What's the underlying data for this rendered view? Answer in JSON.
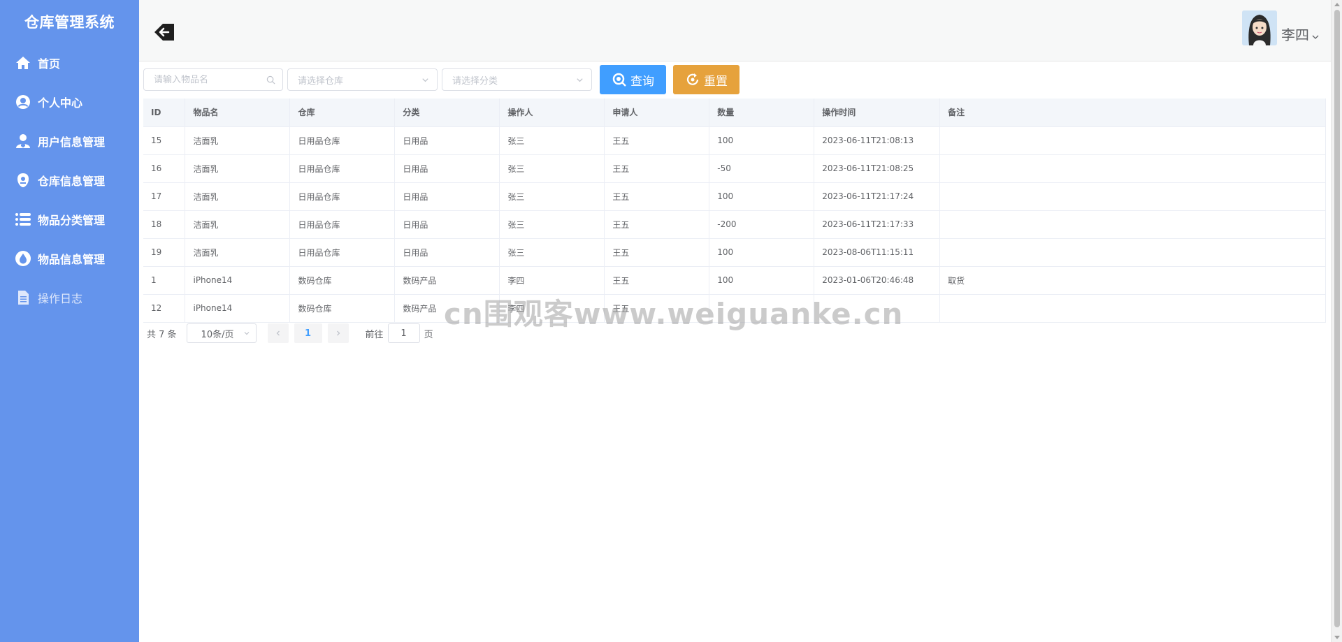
{
  "app": {
    "title": "仓库管理系统"
  },
  "sidebar": {
    "items": [
      {
        "label": "首页",
        "icon": "home-icon"
      },
      {
        "label": "个人中心",
        "icon": "user-center-icon"
      },
      {
        "label": "用户信息管理",
        "icon": "user-manage-icon"
      },
      {
        "label": "仓库信息管理",
        "icon": "warehouse-icon"
      },
      {
        "label": "物品分类管理",
        "icon": "list-icon"
      },
      {
        "label": "物品信息管理",
        "icon": "drop-icon"
      },
      {
        "label": "操作日志",
        "icon": "document-icon",
        "active": true
      }
    ]
  },
  "header": {
    "username": "李四"
  },
  "filters": {
    "name_placeholder": "请输入物品名",
    "warehouse_placeholder": "请选择仓库",
    "category_placeholder": "请选择分类",
    "search_label": "查询",
    "reset_label": "重置"
  },
  "table": {
    "columns": [
      "ID",
      "物品名",
      "仓库",
      "分类",
      "操作人",
      "申请人",
      "数量",
      "操作时间",
      "备注"
    ],
    "rows": [
      [
        "15",
        "洁面乳",
        "日用品仓库",
        "日用品",
        "张三",
        "王五",
        "100",
        "2023-06-11T21:08:13",
        ""
      ],
      [
        "16",
        "洁面乳",
        "日用品仓库",
        "日用品",
        "张三",
        "王五",
        "-50",
        "2023-06-11T21:08:25",
        ""
      ],
      [
        "17",
        "洁面乳",
        "日用品仓库",
        "日用品",
        "张三",
        "王五",
        "100",
        "2023-06-11T21:17:24",
        ""
      ],
      [
        "18",
        "洁面乳",
        "日用品仓库",
        "日用品",
        "张三",
        "王五",
        "-200",
        "2023-06-11T21:17:33",
        ""
      ],
      [
        "19",
        "洁面乳",
        "日用品仓库",
        "日用品",
        "张三",
        "王五",
        "100",
        "2023-08-06T11:15:11",
        ""
      ],
      [
        "1",
        "iPhone14",
        "数码仓库",
        "数码产品",
        "李四",
        "王五",
        "100",
        "2023-01-06T20:46:48",
        "取货"
      ],
      [
        "12",
        "iPhone14",
        "数码仓库",
        "数码产品",
        "李四",
        "王五",
        "",
        "",
        ""
      ]
    ]
  },
  "pagination": {
    "total_text": "共 7 条",
    "page_size": "10条/页",
    "current_page": "1",
    "goto_prefix": "前往",
    "goto_value": "1",
    "goto_suffix": "页"
  },
  "watermark": "cn围观客www.weiguanke.cn",
  "colors": {
    "sidebar": "#6494ec",
    "primary": "#409eff",
    "warning": "#e6a23c"
  }
}
